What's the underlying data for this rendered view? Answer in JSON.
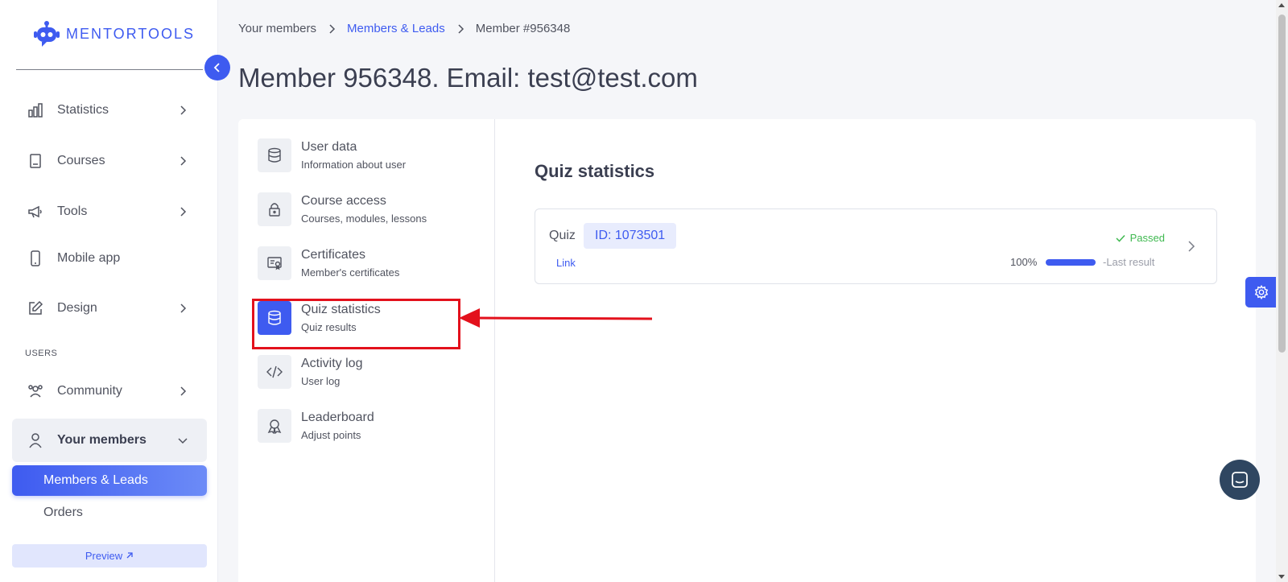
{
  "sidebar": {
    "logo_text": "MENTORTOOLS",
    "nav": [
      {
        "label": "Statistics",
        "icon": "bar-chart-icon"
      },
      {
        "label": "Courses",
        "icon": "book-icon"
      },
      {
        "label": "Tools",
        "icon": "megaphone-icon"
      },
      {
        "label": "Mobile app",
        "icon": "phone-icon"
      },
      {
        "label": "Design",
        "icon": "pencil-icon"
      }
    ],
    "section_users": "USERS",
    "community": "Community",
    "your_members": "Your members",
    "members_leads": "Members & Leads",
    "orders": "Orders",
    "preview": "Preview"
  },
  "breadcrumb": {
    "item1": "Your members",
    "item2": "Members & Leads",
    "item3": "Member #956348"
  },
  "page_title": "Member 956348. Email: test@test.com",
  "menu": [
    {
      "title": "User data",
      "subtitle": "Information about user",
      "icon": "database-icon"
    },
    {
      "title": "Course access",
      "subtitle": "Courses, modules, lessons",
      "icon": "lock-icon"
    },
    {
      "title": "Certificates",
      "subtitle": "Member's certificates",
      "icon": "certificate-icon"
    },
    {
      "title": "Quiz statistics",
      "subtitle": "Quiz results",
      "icon": "database-icon"
    },
    {
      "title": "Activity log",
      "subtitle": "User log",
      "icon": "code-icon"
    },
    {
      "title": "Leaderboard",
      "subtitle": "Adjust points",
      "icon": "award-icon"
    }
  ],
  "quiz_stats": {
    "title": "Quiz statistics",
    "quiz_label": "Quiz",
    "quiz_id": "ID: 1073501",
    "link": "Link",
    "status": "Passed",
    "percent": "100%",
    "progress": 1.0,
    "last_result": "-Last result"
  },
  "colors": {
    "accent": "#3e5bf0",
    "passed": "#3fb950",
    "highlight": "#e3111c"
  }
}
